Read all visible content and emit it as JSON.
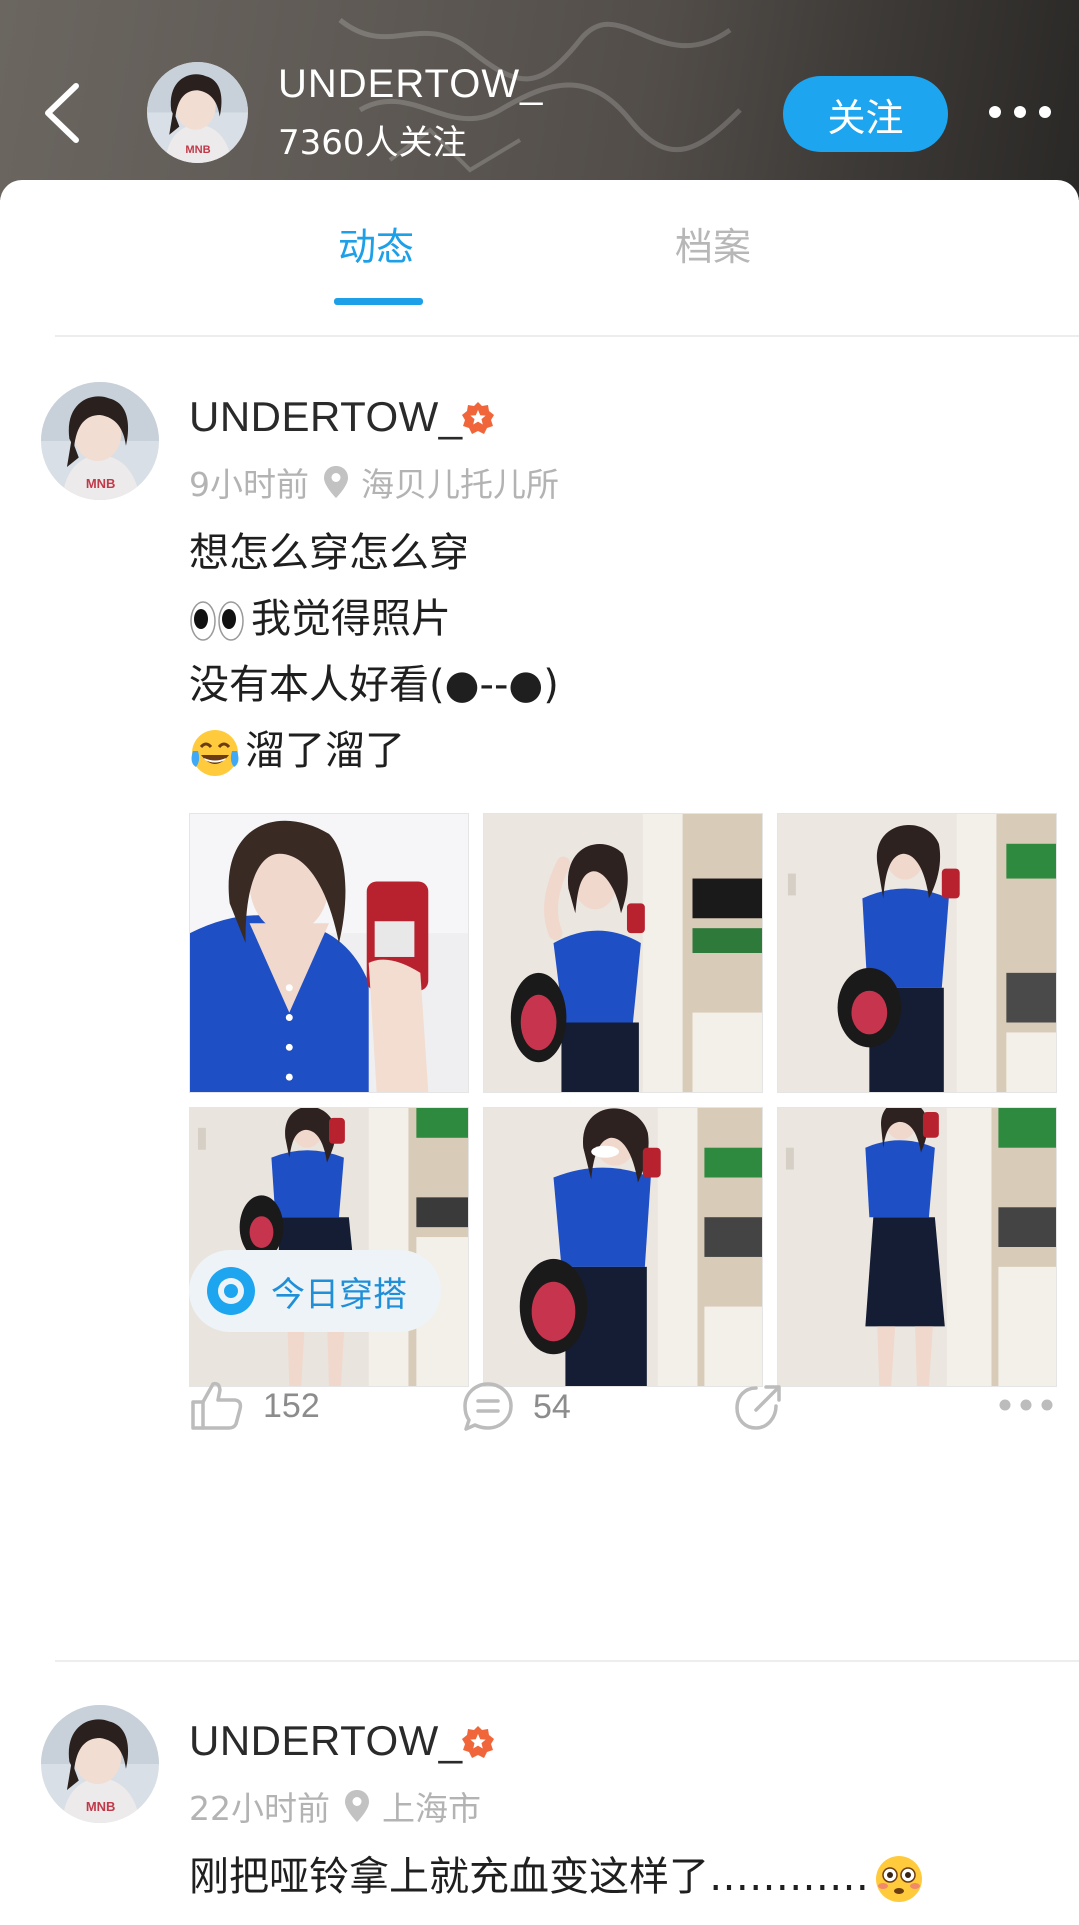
{
  "header": {
    "username": "UNDERTOW_",
    "followers_text": "7360人关注",
    "follow_label": "关注"
  },
  "tabs": [
    {
      "label": "动态",
      "active": true
    },
    {
      "label": "档案",
      "active": false
    }
  ],
  "posts": [
    {
      "username": "UNDERTOW_",
      "time": "9小时前",
      "location": "海贝儿托儿所",
      "lines": [
        "想怎么穿怎么穿",
        "我觉得照片",
        "没有本人好看(●--●)",
        "溜了溜了"
      ],
      "photo_count": 6,
      "tag": "今日穿搭",
      "likes": "152",
      "comments": "54"
    },
    {
      "username": "UNDERTOW_",
      "time": "22小时前",
      "location": "上海市",
      "lines": [
        "刚把哑铃拿上就充血变这样了…………"
      ]
    }
  ],
  "colors": {
    "accent": "#1ea0e8",
    "follow_button": "#1ea5f0",
    "shirt_blue": "#1f4fc4",
    "badge_orange": "#f0663a"
  }
}
